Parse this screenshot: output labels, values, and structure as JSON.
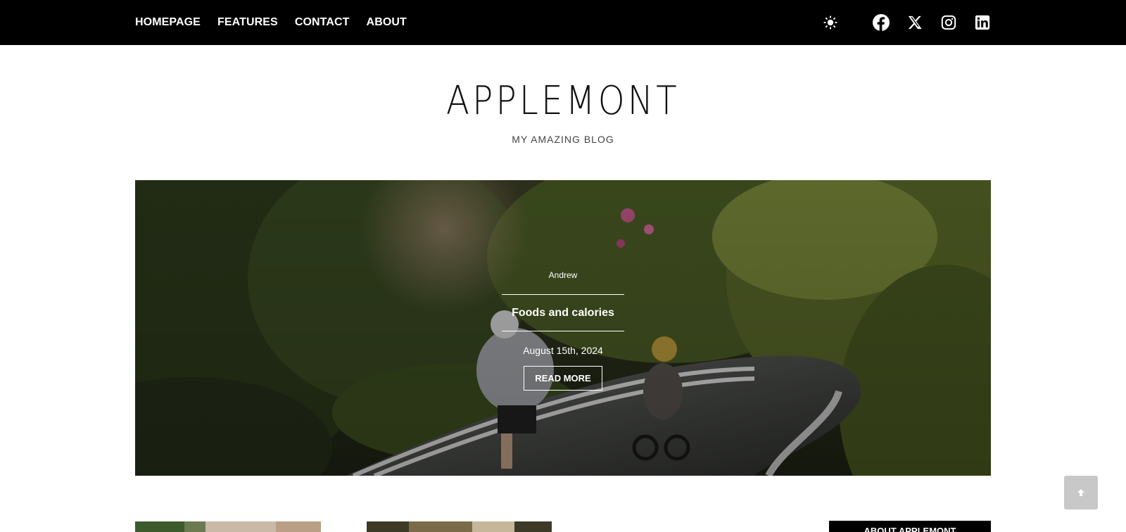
{
  "nav": {
    "items": [
      "HOMEPAGE",
      "FEATURES",
      "CONTACT",
      "ABOUT"
    ]
  },
  "icons": {
    "theme": "sun-icon",
    "social": [
      "facebook-icon",
      "x-icon",
      "instagram-icon",
      "linkedin-icon"
    ]
  },
  "header": {
    "title": "APPLEMONT",
    "tagline": "MY AMAZING BLOG"
  },
  "hero": {
    "author": "Andrew",
    "title": "Foods and calories",
    "date": "August 15th, 2024",
    "button": "READ MORE"
  },
  "sidebar": {
    "about_heading": "ABOUT APPLEMONT"
  },
  "colors": {
    "topbar": "#000000",
    "text_on_dark": "#ffffff",
    "scroll_button": "#c8c8c8"
  }
}
